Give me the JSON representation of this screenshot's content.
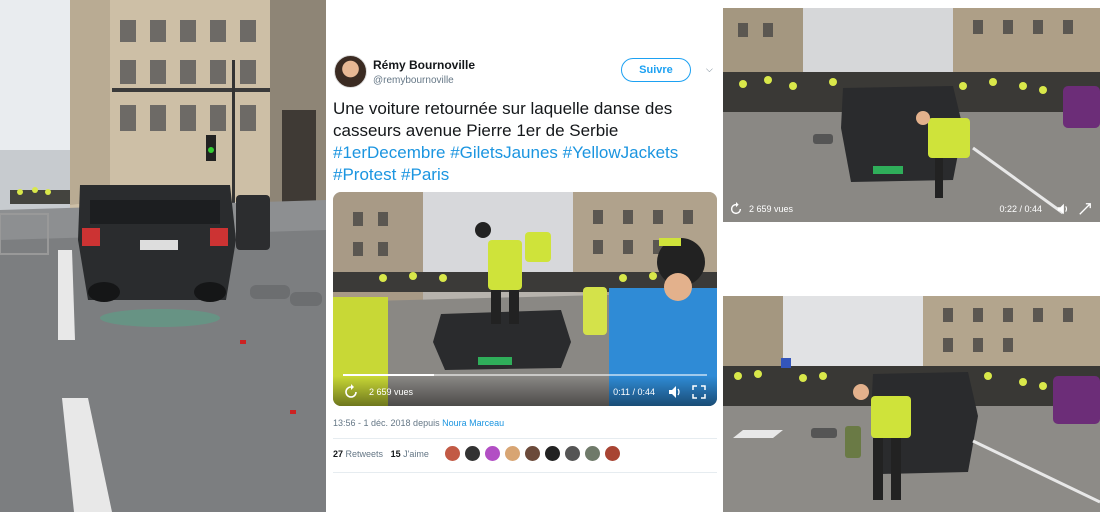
{
  "tweet": {
    "author_name": "Rémy Bournoville",
    "author_handle": "@remybournoville",
    "follow_label": "Suivre",
    "text": "Une voiture retournée sur laquelle danse des casseurs avenue Pierre 1er de Serbie ",
    "hashtags": [
      "#1erDecembre",
      "#GiletsJaunes",
      "#YellowJackets",
      "#Protest",
      "#Paris"
    ],
    "video": {
      "views": "2 659 vues",
      "time": "0:11 / 0:44"
    },
    "timestamp": "13:56 - 1 déc. 2018 depuis ",
    "source": "Noura Marceau",
    "retweets_count": "27",
    "retweets_label": "Retweets",
    "likes_count": "15",
    "likes_label": "J'aime"
  },
  "right_videos": [
    {
      "views": "2 659 vues",
      "time": "0:22 / 0:44"
    }
  ],
  "colors": {
    "twitter_blue": "#1da1f2",
    "hashtag_blue": "#1b95e0",
    "vest_yellow": "#d9e84a"
  },
  "icons": [
    "replay-icon",
    "volume-icon",
    "fullscreen-icon",
    "chevron-down-icon"
  ]
}
